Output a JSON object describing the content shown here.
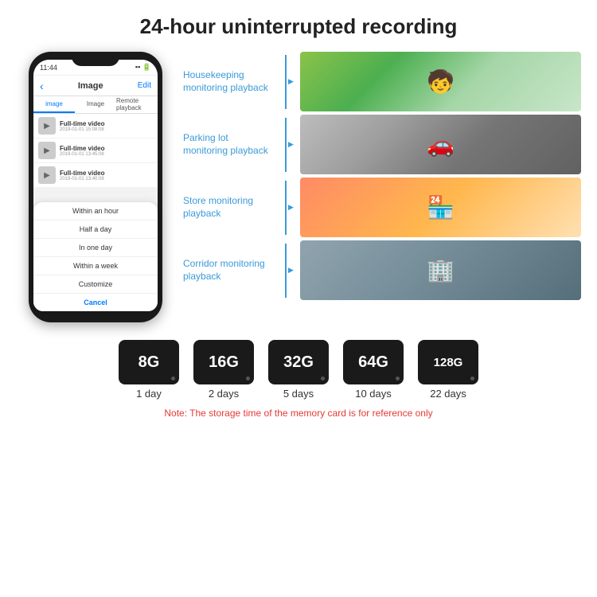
{
  "title": "24-hour uninterrupted recording",
  "phone": {
    "time": "11:44",
    "header": {
      "back": "‹",
      "title": "Image",
      "edit": "Edit"
    },
    "tabs": [
      "image",
      "Image",
      "Remote playback"
    ],
    "list_items": [
      {
        "title": "Full-time video",
        "date": "2019-01-01 15:08:08"
      },
      {
        "title": "Full-time video",
        "date": "2019-01-01 13:45:08"
      },
      {
        "title": "Full-time video",
        "date": "2019-01-01 13:40:08"
      }
    ],
    "dropdown": {
      "items": [
        "Within an hour",
        "Half a day",
        "In one day",
        "Within a week",
        "Customize"
      ],
      "cancel": "Cancel"
    }
  },
  "monitoring": [
    {
      "label": "Housekeeping\nmonitoring playback",
      "img_class": "img-housekeeping",
      "icon": "🧒"
    },
    {
      "label": "Parking lot\nmonitoring playback",
      "img_class": "img-parking",
      "icon": "🚗"
    },
    {
      "label": "Store monitoring\nplayback",
      "img_class": "img-store",
      "icon": "🏪"
    },
    {
      "label": "Corridor monitoring\nplayback",
      "img_class": "img-corridor",
      "icon": "🏢"
    }
  ],
  "sdcards": [
    {
      "size": "8G",
      "days": "1 day"
    },
    {
      "size": "16G",
      "days": "2 days"
    },
    {
      "size": "32G",
      "days": "5 days"
    },
    {
      "size": "64G",
      "days": "10 days"
    },
    {
      "size": "128G",
      "days": "22 days"
    }
  ],
  "note": "Note: The storage time of the memory card is for reference only"
}
